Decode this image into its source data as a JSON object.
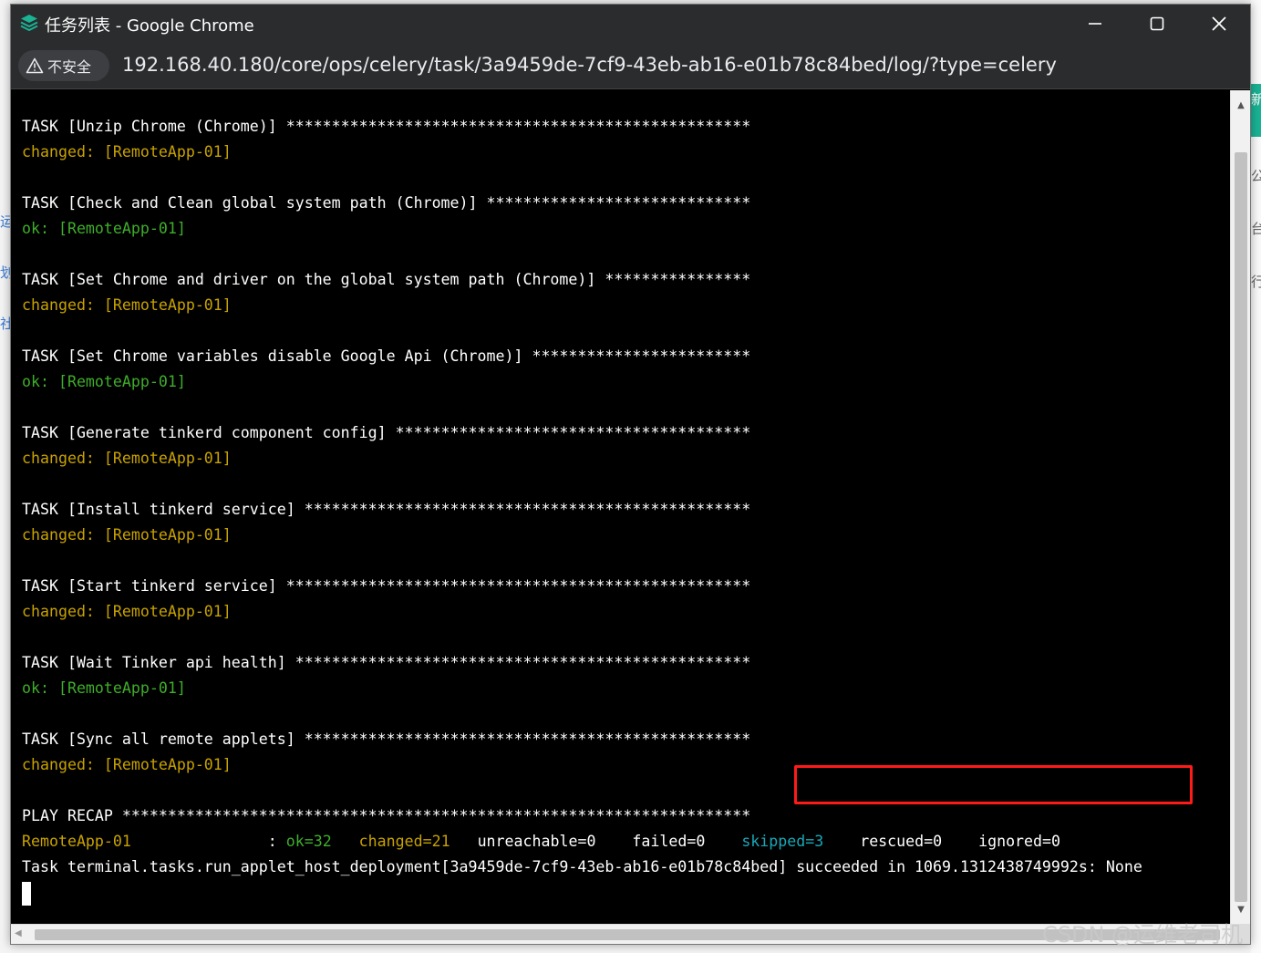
{
  "window": {
    "title": "任务列表 - Google Chrome",
    "icon": "app-logo-icon",
    "controls": [
      "minimize-icon",
      "maximize-icon",
      "close-icon"
    ]
  },
  "address_bar": {
    "security_label": "不安全",
    "url": "192.168.40.180/core/ops/celery/task/3a9459de-7cf9-43eb-ab16-e01b78c84bed/log/?type=celery"
  },
  "colors": {
    "terminal_bg": "#000000",
    "text": "#ffffff",
    "changed": "#c8a200",
    "ok": "#3fae2a",
    "skipped": "#18a8b8",
    "highlight_border": "#ff1a1a"
  },
  "log": {
    "tasks": [
      {
        "header": "TASK [Unzip Chrome (Chrome)] ***************************************************",
        "status": "changed: [RemoteApp-01]",
        "status_type": "changed"
      },
      {
        "header": "TASK [Check and Clean global system path (Chrome)] *****************************",
        "status": "ok: [RemoteApp-01]",
        "status_type": "ok"
      },
      {
        "header": "TASK [Set Chrome and driver on the global system path (Chrome)] ****************",
        "status": "changed: [RemoteApp-01]",
        "status_type": "changed"
      },
      {
        "header": "TASK [Set Chrome variables disable Google Api (Chrome)] ************************",
        "status": "ok: [RemoteApp-01]",
        "status_type": "ok"
      },
      {
        "header": "TASK [Generate tinkerd component config] ***************************************",
        "status": "changed: [RemoteApp-01]",
        "status_type": "changed"
      },
      {
        "header": "TASK [Install tinkerd service] *************************************************",
        "status": "changed: [RemoteApp-01]",
        "status_type": "changed"
      },
      {
        "header": "TASK [Start tinkerd service] ***************************************************",
        "status": "changed: [RemoteApp-01]",
        "status_type": "changed"
      },
      {
        "header": "TASK [Wait Tinker api health] **************************************************",
        "status": "ok: [RemoteApp-01]",
        "status_type": "ok"
      },
      {
        "header": "TASK [Sync all remote applets] *************************************************",
        "status": "changed: [RemoteApp-01]",
        "status_type": "changed"
      }
    ],
    "recap_header": "PLAY RECAP *********************************************************************",
    "recap": {
      "host": "RemoteApp-01",
      "sep": "               : ",
      "ok": "ok=32",
      "changed": "changed=21",
      "unreachable": "unreachable=0",
      "failed": "failed=0",
      "skipped": "skipped=3",
      "rescued": "rescued=0",
      "ignored": "ignored=0"
    },
    "final_prefix": "Task terminal.tasks.run_applet_host_deployment[3a9459de-7cf9-43eb-ab16-e01b78c84bed] ",
    "final_result": "succeeded in 1069.1312438749992s: None"
  },
  "watermark": "CSDN @运维老司机",
  "background_fragments": [
    "新",
    "运",
    "划",
    "社",
    "公",
    "台",
    "行"
  ]
}
